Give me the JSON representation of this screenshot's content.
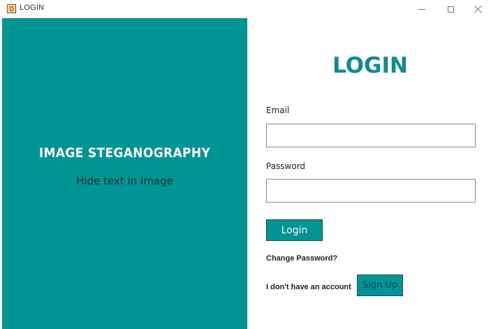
{
  "window": {
    "title": "LOGIN",
    "icon": "java-app-icon"
  },
  "brand": {
    "title": "IMAGE STEGANOGRAPHY",
    "subtitle": "Hide text in Image"
  },
  "form": {
    "heading": "LOGIN",
    "email_label": "Email",
    "email_value": "",
    "password_label": "Password",
    "password_value": "",
    "login_label": "Login",
    "change_password_label": "Change Password?",
    "no_account_text": "I don't have an account",
    "signup_label": "Sign Up"
  },
  "colors": {
    "accent": "#009494",
    "heading": "#0b8d92"
  }
}
